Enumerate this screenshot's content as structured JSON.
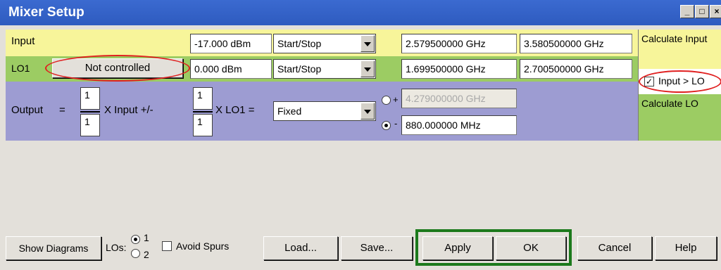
{
  "window": {
    "title": "Mixer Setup"
  },
  "input_row": {
    "label": "Input",
    "power": "-17.000 dBm",
    "mode": "Start/Stop",
    "start": "2.579500000 GHz",
    "stop": "3.580500000 GHz",
    "side_button": "Calculate Input"
  },
  "lo1_row": {
    "label": "LO1",
    "control_button": "Not controlled",
    "power": "0.000 dBm",
    "mode": "Start/Stop",
    "start": "1.699500000 GHz",
    "stop": "2.700500000 GHz",
    "checkbox_label": "Input > LO",
    "checkbox_checked": true
  },
  "output_row": {
    "label": "Output",
    "equals": "=",
    "mult1_num": "1",
    "mult1_den": "1",
    "times_input": "X Input +/-",
    "mult2_num": "1",
    "mult2_den": "1",
    "times_lo": "X LO1 =",
    "mode": "Fixed",
    "plus_sign": "+",
    "minus_sign": "-",
    "plus_value": "4.279000000 GHz",
    "minus_value": "880.000000 MHz",
    "minus_selected": true,
    "side_button": "Calculate LO"
  },
  "bottom": {
    "show_diagrams": "Show Diagrams",
    "los_label": "LOs:",
    "lo_option_1": "1",
    "lo_option_2": "2",
    "lo_selected": "1",
    "avoid_spurs": "Avoid Spurs",
    "load": "Load...",
    "save": "Save...",
    "apply": "Apply",
    "ok": "OK",
    "cancel": "Cancel",
    "help": "Help"
  },
  "colors": {
    "input_row": "#f7f59a",
    "lo1_row": "#9ccc63",
    "output_row": "#9d9cd2",
    "highlight_oval": "#e02020",
    "apply_ok_frame": "#1c7a1c",
    "titlebar": "#2e5bbf"
  }
}
